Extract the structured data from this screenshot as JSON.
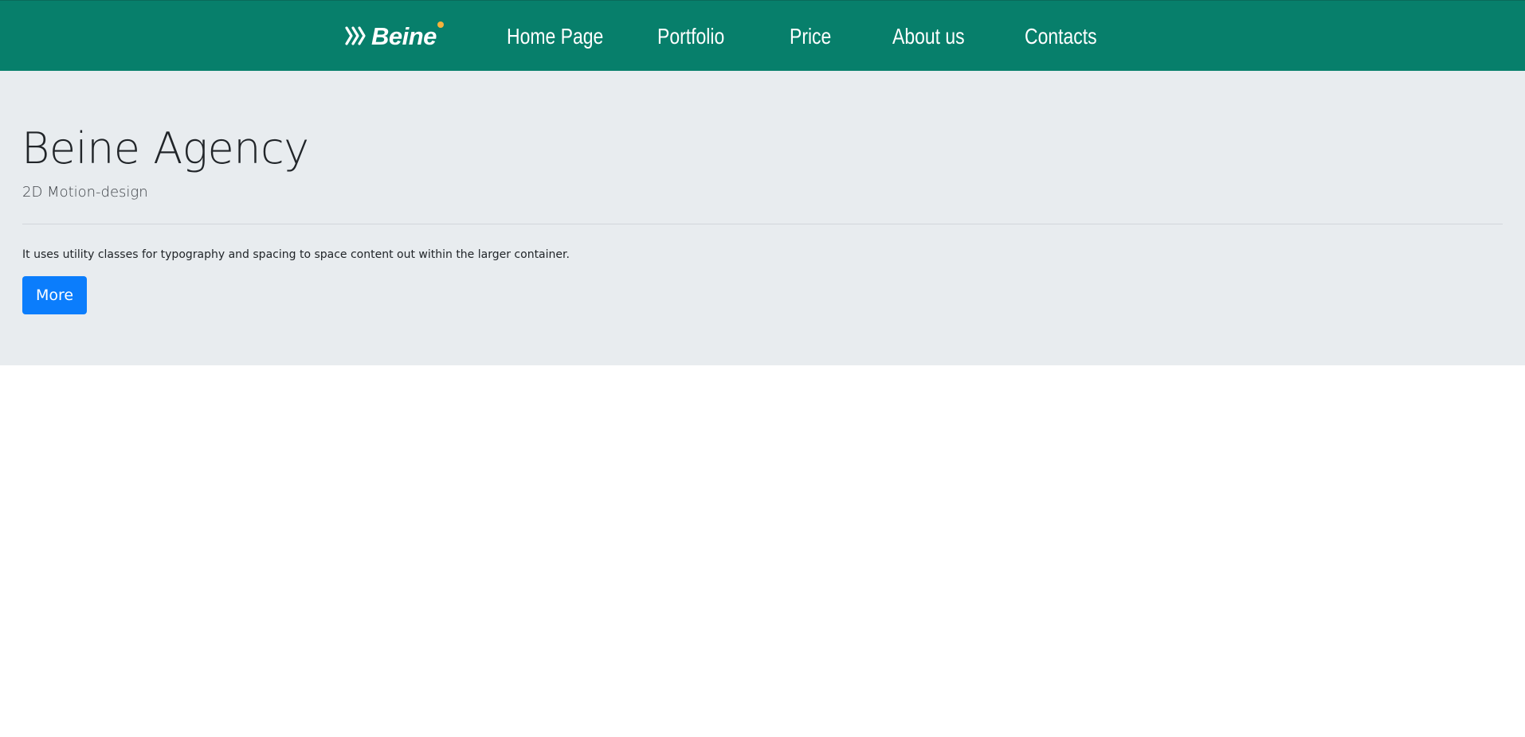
{
  "brand": {
    "logo_text": "Beine",
    "logo_icon": "triple-chevron-icon",
    "accent_dot_color": "#f5b23c"
  },
  "navbar": {
    "background_color": "#077f6b",
    "items": [
      {
        "label": "Home Page"
      },
      {
        "label": "Portfolio"
      },
      {
        "label": "Price"
      },
      {
        "label": "About us"
      },
      {
        "label": "Contacts"
      }
    ]
  },
  "hero": {
    "title": "Beine Agency",
    "subtitle": "2D Motion-design",
    "body": "It uses utility classes for typography and spacing to space content out within the larger container.",
    "button_label": "More",
    "button_color": "#0b7dfc",
    "background_color": "#e8ecef"
  }
}
